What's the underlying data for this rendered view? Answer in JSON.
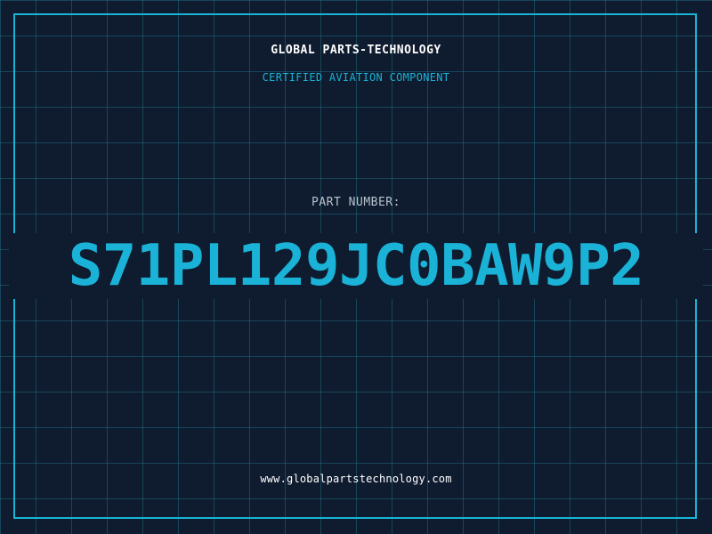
{
  "header": {
    "company": "GLOBAL PARTS-TECHNOLOGY",
    "tagline": "CERTIFIED AVIATION COMPONENT"
  },
  "part": {
    "label": "PART NUMBER:",
    "number": "S71PL129JC0BAW9P2"
  },
  "footer": {
    "website": "www.globalpartstechnology.com"
  },
  "colors": {
    "background": "#0f1b2e",
    "grid": "#20697d",
    "accent": "#1ab2d6",
    "text": "#ffffff",
    "label": "#b8c3cf"
  }
}
